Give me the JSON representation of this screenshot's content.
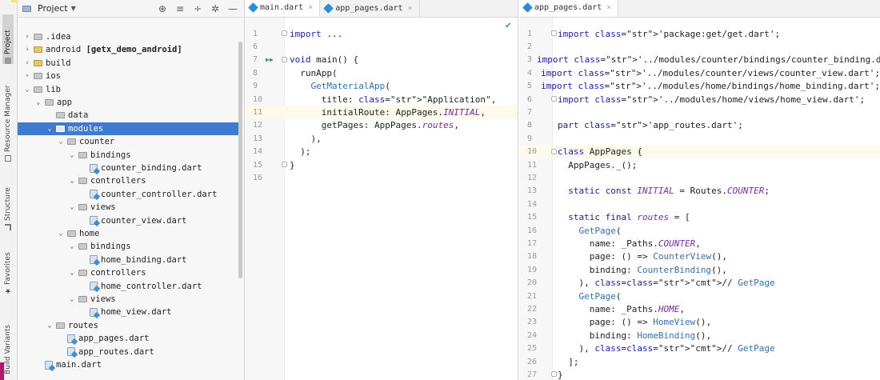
{
  "tool_strip": {
    "tabs": [
      {
        "label": "Project",
        "icon": "folder-icon"
      },
      {
        "label": "Resource Manager",
        "icon": "resource-icon"
      },
      {
        "label": "Structure",
        "icon": "structure-icon"
      },
      {
        "label": "Favorites",
        "icon": "star-icon"
      },
      {
        "label": "Build Variants",
        "icon": "build-icon"
      }
    ]
  },
  "project_panel": {
    "title": "Project",
    "tools": [
      "target-icon",
      "collapse-all-icon",
      "expand-icon",
      "gear-icon",
      "minimize-icon"
    ],
    "tree": [
      {
        "label": ".idea",
        "depth": 1,
        "chevron": "›",
        "icon": "folder"
      },
      {
        "label": "android [getx_demo_android]",
        "depth": 1,
        "chevron": "›",
        "icon": "folder-yellow"
      },
      {
        "label": "build",
        "depth": 1,
        "chevron": "›",
        "icon": "folder-yellow"
      },
      {
        "label": "ios",
        "depth": 1,
        "chevron": "›",
        "icon": "folder"
      },
      {
        "label": "lib",
        "depth": 1,
        "chevron": "⌄",
        "icon": "folder"
      },
      {
        "label": "app",
        "depth": 2,
        "chevron": "⌄",
        "icon": "folder"
      },
      {
        "label": "data",
        "depth": 3,
        "chevron": "",
        "icon": "folder"
      },
      {
        "label": "modules",
        "depth": 3,
        "chevron": "⌄",
        "icon": "folder",
        "selected": true
      },
      {
        "label": "counter",
        "depth": 4,
        "chevron": "⌄",
        "icon": "folder"
      },
      {
        "label": "bindings",
        "depth": 5,
        "chevron": "⌄",
        "icon": "folder"
      },
      {
        "label": "counter_binding.dart",
        "depth": 6,
        "chevron": "",
        "icon": "dart"
      },
      {
        "label": "controllers",
        "depth": 5,
        "chevron": "⌄",
        "icon": "folder"
      },
      {
        "label": "counter_controller.dart",
        "depth": 6,
        "chevron": "",
        "icon": "dart"
      },
      {
        "label": "views",
        "depth": 5,
        "chevron": "⌄",
        "icon": "folder"
      },
      {
        "label": "counter_view.dart",
        "depth": 6,
        "chevron": "",
        "icon": "dart"
      },
      {
        "label": "home",
        "depth": 4,
        "chevron": "⌄",
        "icon": "folder"
      },
      {
        "label": "bindings",
        "depth": 5,
        "chevron": "⌄",
        "icon": "folder"
      },
      {
        "label": "home_binding.dart",
        "depth": 6,
        "chevron": "",
        "icon": "dart"
      },
      {
        "label": "controllers",
        "depth": 5,
        "chevron": "⌄",
        "icon": "folder"
      },
      {
        "label": "home_controller.dart",
        "depth": 6,
        "chevron": "",
        "icon": "dart"
      },
      {
        "label": "views",
        "depth": 5,
        "chevron": "⌄",
        "icon": "folder"
      },
      {
        "label": "home_view.dart",
        "depth": 6,
        "chevron": "",
        "icon": "dart"
      },
      {
        "label": "routes",
        "depth": 3,
        "chevron": "⌄",
        "icon": "folder"
      },
      {
        "label": "app_pages.dart",
        "depth": 4,
        "chevron": "",
        "icon": "dart"
      },
      {
        "label": "app_routes.dart",
        "depth": 4,
        "chevron": "",
        "icon": "dart"
      },
      {
        "label": "main.dart",
        "depth": 2,
        "chevron": "",
        "icon": "dart"
      }
    ]
  },
  "editor_left": {
    "tabs": [
      {
        "label": "main.dart",
        "active": true
      },
      {
        "label": "app_pages.dart",
        "active": false
      }
    ],
    "lines": [
      {
        "n": "1",
        "text": "import ...",
        "style": "import"
      },
      {
        "n": "6",
        "text": ""
      },
      {
        "n": "7",
        "text": "void main() {",
        "style": "main",
        "run": true
      },
      {
        "n": "8",
        "text": "  runApp("
      },
      {
        "n": "9",
        "text": "    GetMaterialApp(",
        "style": "call"
      },
      {
        "n": "10",
        "text": "      title: \"Application\",",
        "style": "title"
      },
      {
        "n": "11",
        "text": "      initialRoute: AppPages.INITIAL,",
        "style": "initial",
        "hl": true
      },
      {
        "n": "12",
        "text": "      getPages: AppPages.routes,",
        "style": "routes"
      },
      {
        "n": "13",
        "text": "    ),"
      },
      {
        "n": "14",
        "text": "  );"
      },
      {
        "n": "15",
        "text": "}"
      },
      {
        "n": "16",
        "text": ""
      }
    ]
  },
  "editor_right": {
    "tabs": [
      {
        "label": "app_pages.dart",
        "active": true
      }
    ],
    "lines": [
      {
        "n": "1",
        "text": "import 'package:get/get.dart';",
        "style": "import-str"
      },
      {
        "n": "2",
        "text": ""
      },
      {
        "n": "3",
        "text": "import '../modules/counter/bindings/counter_binding.dart';",
        "style": "import-str"
      },
      {
        "n": "4",
        "text": "import '../modules/counter/views/counter_view.dart';",
        "style": "import-str"
      },
      {
        "n": "5",
        "text": "import '../modules/home/bindings/home_binding.dart';",
        "style": "import-str"
      },
      {
        "n": "6",
        "text": "import '../modules/home/views/home_view.dart';",
        "style": "import-str"
      },
      {
        "n": "7",
        "text": ""
      },
      {
        "n": "8",
        "text": "part 'app_routes.dart';",
        "style": "part"
      },
      {
        "n": "9",
        "text": ""
      },
      {
        "n": "10",
        "text": "class AppPages {",
        "style": "class",
        "hl": true
      },
      {
        "n": "11",
        "text": "  AppPages._();"
      },
      {
        "n": "12",
        "text": ""
      },
      {
        "n": "13",
        "text": "  static const INITIAL = Routes.COUNTER;",
        "style": "const"
      },
      {
        "n": "14",
        "text": ""
      },
      {
        "n": "15",
        "text": "  static final routes = [",
        "style": "final"
      },
      {
        "n": "16",
        "text": "    GetPage(",
        "style": "getpage"
      },
      {
        "n": "17",
        "text": "      name: _Paths.COUNTER,",
        "style": "name"
      },
      {
        "n": "18",
        "text": "      page: () => CounterView(),",
        "style": "page"
      },
      {
        "n": "19",
        "text": "      binding: CounterBinding(),",
        "style": "binding"
      },
      {
        "n": "20",
        "text": "    ), // GetPage",
        "style": "cmt"
      },
      {
        "n": "21",
        "text": "    GetPage(",
        "style": "getpage"
      },
      {
        "n": "22",
        "text": "      name: _Paths.HOME,",
        "style": "name"
      },
      {
        "n": "23",
        "text": "      page: () => HomeView(),",
        "style": "page"
      },
      {
        "n": "24",
        "text": "      binding: HomeBinding(),",
        "style": "binding"
      },
      {
        "n": "25",
        "text": "    ), // GetPage",
        "style": "cmt"
      },
      {
        "n": "26",
        "text": "  ];"
      },
      {
        "n": "27",
        "text": "}"
      }
    ]
  }
}
